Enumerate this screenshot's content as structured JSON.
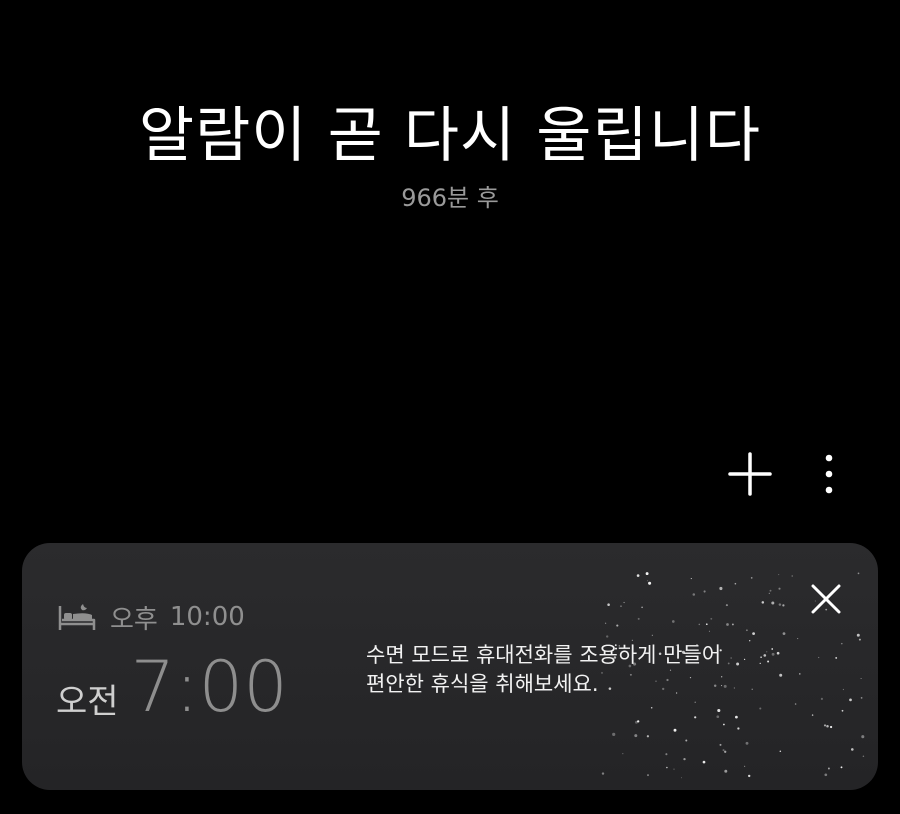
{
  "header": {
    "title": "알람이 곧 다시 울립니다",
    "subtitle": "966분 후"
  },
  "toolbar": {
    "add_icon": "plus-icon",
    "more_icon": "more-vertical-icon"
  },
  "sleep_card": {
    "bedtime_icon": "bed-icon",
    "bedtime_ampm": "오후",
    "bedtime_time": "10:00",
    "wake_ampm": "오전",
    "wake_time": "7:00",
    "message_lines": [
      "수면 모드로 휴대전화를 조용하게 만들어",
      "편안한 휴식을 취해보세요."
    ],
    "close_icon": "close-icon"
  },
  "colors": {
    "background": "#000000",
    "card": "#2a2a2c",
    "subtitle": "#9a9a9a",
    "bedtime_text": "#8f8f8f",
    "wake_time": "#8e8e8e"
  }
}
